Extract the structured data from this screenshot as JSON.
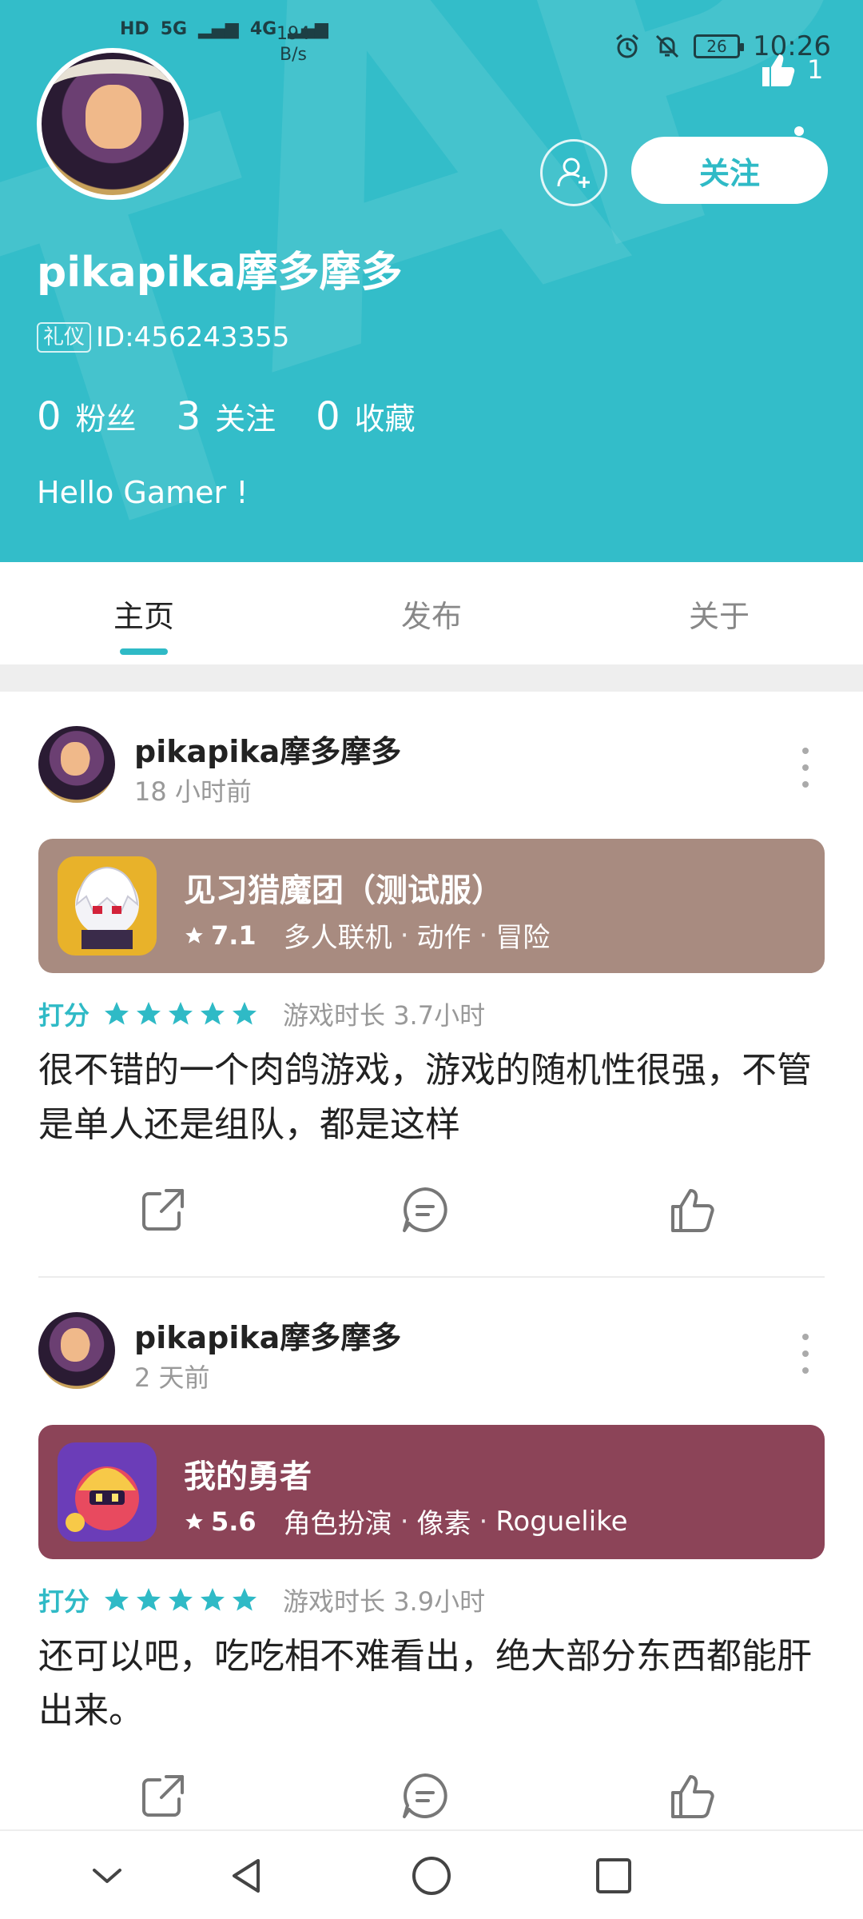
{
  "status_bar": {
    "net1": "HD",
    "net2": "5G",
    "net3": "4G",
    "speed_value": "194",
    "speed_unit": "B/s",
    "battery": "26",
    "time": "10:26"
  },
  "profile": {
    "like_count": "1",
    "follow_label": "关注",
    "username": "pikapika摩多摩多",
    "tag": "礼仪",
    "id_text": "ID:456243355",
    "stats": [
      {
        "value": "0",
        "label": "粉丝"
      },
      {
        "value": "3",
        "label": "关注"
      },
      {
        "value": "0",
        "label": "收藏"
      }
    ],
    "bio": "Hello Gamer !"
  },
  "tabs": [
    {
      "label": "主页",
      "active": true
    },
    {
      "label": "发布",
      "active": false
    },
    {
      "label": "关于",
      "active": false
    }
  ],
  "posts": [
    {
      "author": "pikapika摩多摩多",
      "time": "18 小时前",
      "game": {
        "title": "见习猎魔团（测试服）",
        "score": "7.1",
        "tags": [
          "多人联机",
          "动作",
          "冒险"
        ],
        "card_color": "#a88b80"
      },
      "rating_label": "打分",
      "stars": 5,
      "playtime": "游戏时长 3.7小时",
      "review": "很不错的一个肉鸽游戏，游戏的随机性很强，不管是单人还是组队，都是这样"
    },
    {
      "author": "pikapika摩多摩多",
      "time": "2 天前",
      "game": {
        "title": "我的勇者",
        "score": "5.6",
        "tags": [
          "角色扮演",
          "像素",
          "Roguelike"
        ],
        "card_color": "#8c4458"
      },
      "rating_label": "打分",
      "stars": 5,
      "playtime": "游戏时长 3.9小时",
      "review": "还可以吧，吃吃相不难看出，绝大部分东西都能肝出来。"
    }
  ],
  "colors": {
    "header_bg": "#33bdc9",
    "accent": "#2fbac6"
  },
  "icons": [
    "thumb-up-icon",
    "add-friend-icon",
    "share-icon",
    "comment-icon",
    "like-icon",
    "more-icon",
    "star-icon",
    "chevron-down-icon",
    "back-icon",
    "home-icon",
    "recents-icon",
    "alarm-icon",
    "mute-icon"
  ]
}
